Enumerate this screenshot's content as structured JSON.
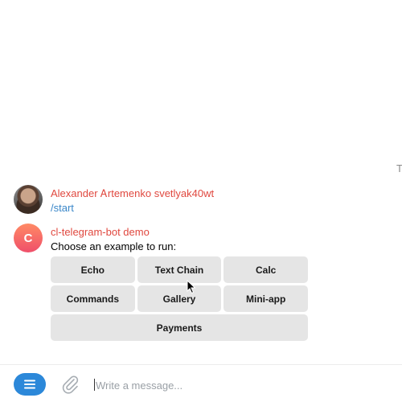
{
  "top_right_fragment": "T",
  "messages": [
    {
      "sender": "Alexander Ꭺrtemenko svetlyak40wt",
      "text": "/start",
      "avatar_icon": "user-photo"
    },
    {
      "sender": "cl-telegram-bot demo",
      "text": "Choose an example to run:",
      "avatar_letter": "C"
    }
  ],
  "keyboard": {
    "rows": [
      [
        "Echo",
        "Text Chain",
        "Calc"
      ],
      [
        "Commands",
        "Gallery",
        "Mini-app"
      ],
      [
        "Payments"
      ]
    ]
  },
  "composer": {
    "menu_icon": "menu-icon",
    "attach_icon": "paperclip-icon",
    "placeholder": "Write a message..."
  },
  "colors": {
    "sender_name": "#e0483f",
    "link": "#3a87c9",
    "menu_button": "#2c88d9",
    "keyboard_button": "#e5e5e5"
  }
}
